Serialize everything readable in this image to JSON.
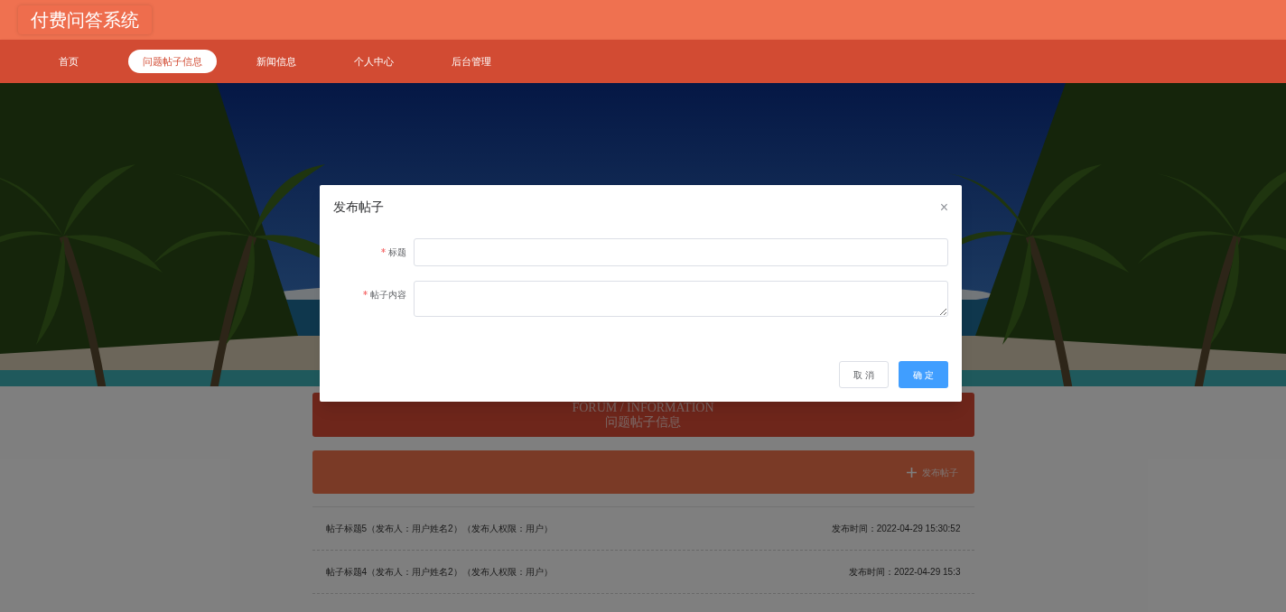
{
  "header": {
    "title": "付费问答系统"
  },
  "nav": [
    {
      "label": "首页",
      "selected": false
    },
    {
      "label": "问题帖子信息",
      "selected": true
    },
    {
      "label": "新闻信息",
      "selected": false
    },
    {
      "label": "个人中心",
      "selected": false
    },
    {
      "label": "后台管理",
      "selected": false
    }
  ],
  "section": {
    "title_en": "FORUM / INFORMATION",
    "title": "问题帖子信息"
  },
  "toolbar": {
    "add_button": "发布帖子"
  },
  "posts": [
    {
      "title": "帖子标题5（发布人：用户姓名2）（发布人权限：用户）",
      "time": "发布时间：2022-04-29 15:30:52"
    },
    {
      "title": "帖子标题4（发布人：用户姓名2）（发布人权限：用户）",
      "time": "发布时间：2022-04-29 15:3"
    }
  ],
  "dialog": {
    "title": "发布帖子",
    "close": "×",
    "fields": [
      {
        "label": "标题",
        "required": true,
        "kind": "input"
      },
      {
        "label": "帖子内容",
        "required": true,
        "kind": "textarea"
      }
    ],
    "buttons": [
      {
        "label": "取 消",
        "kind": "default"
      },
      {
        "label": "确 定",
        "kind": "primary"
      }
    ]
  }
}
